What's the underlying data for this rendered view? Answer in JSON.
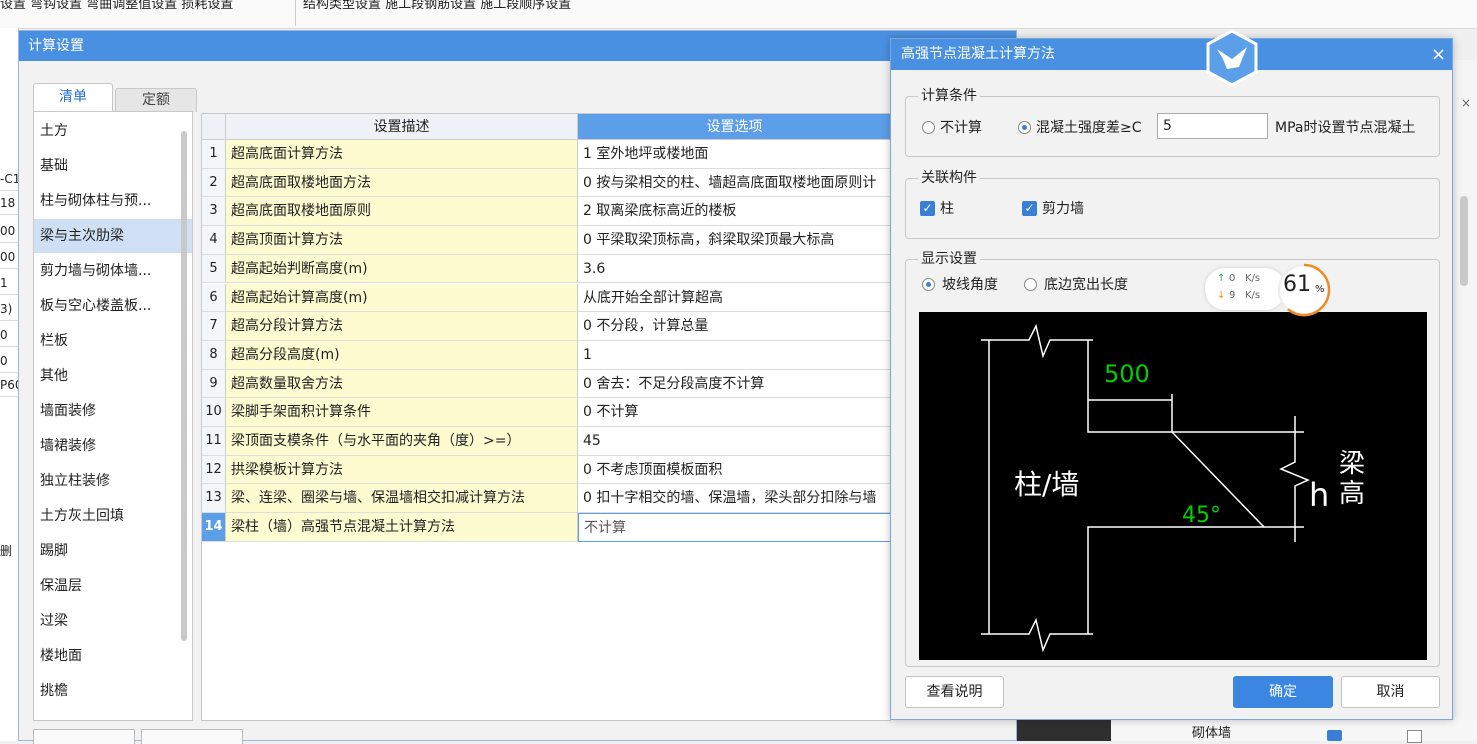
{
  "background": {
    "tabs_a": "设置  弯钩设置  弯曲调整值设置  损耗设置",
    "tabs_b": "结构类型设置  施工段钢筋设置  施工段顺序设置",
    "left_cells": [
      "-C1",
      "18",
      "00",
      "00",
      "1",
      "3)",
      "0",
      "0",
      "P60"
    ],
    "bottom_partial": "删",
    "bottom_right_text": "砌体墙",
    "right_close": "×"
  },
  "dialog": {
    "title": "计算设置",
    "tabs": [
      {
        "label": "清单"
      },
      {
        "label": "定额"
      }
    ],
    "categories": [
      "土方",
      "基础",
      "柱与砌体柱与预...",
      "梁与主次肋梁",
      "剪力墙与砌体墙...",
      "板与空心楼盖板...",
      "栏板",
      "其他",
      "墙面装修",
      "墙裙装修",
      "独立柱装修",
      "土方灰土回填",
      "踢脚",
      "保温层",
      "过梁",
      "楼地面",
      "挑檐"
    ],
    "selected_category": 3,
    "grid": {
      "headers": {
        "desc": "设置描述",
        "opt": "设置选项"
      },
      "rows": [
        {
          "num": "1",
          "desc": "超高底面计算方法",
          "opt": "1 室外地坪或楼地面"
        },
        {
          "num": "2",
          "desc": "超高底面取楼地面方法",
          "opt": "0 按与梁相交的柱、墙超高底面取楼地面原则计"
        },
        {
          "num": "3",
          "desc": "超高底面取楼地面原则",
          "opt": "2 取离梁底标高近的楼板"
        },
        {
          "num": "4",
          "desc": "超高顶面计算方法",
          "opt": "0 平梁取梁顶标高，斜梁取梁顶最大标高"
        },
        {
          "num": "5",
          "desc": "超高起始判断高度(m)",
          "opt": "3.6"
        },
        {
          "num": "6",
          "desc": "超高起始计算高度(m)",
          "opt": "从底开始全部计算超高"
        },
        {
          "num": "7",
          "desc": "超高分段计算方法",
          "opt": "0 不分段，计算总量"
        },
        {
          "num": "8",
          "desc": "超高分段高度(m)",
          "opt": "1"
        },
        {
          "num": "9",
          "desc": "超高数量取舍方法",
          "opt": "0 舍去：不足分段高度不计算"
        },
        {
          "num": "10",
          "desc": "梁脚手架面积计算条件",
          "opt": "0 不计算"
        },
        {
          "num": "11",
          "desc": "梁顶面支模条件（与水平面的夹角（度）>=）",
          "opt": "45"
        },
        {
          "num": "12",
          "desc": "拱梁模板计算方法",
          "opt": "0 不考虑顶面模板面积"
        },
        {
          "num": "13",
          "desc": "梁、连梁、圈梁与墙、保温墙相交扣减计算方法",
          "opt": "0 扣十字相交的墙、保温墙，梁头部分扣除与墙"
        },
        {
          "num": "14",
          "desc": "梁柱（墙）高强节点混凝土计算方法",
          "opt": "不计算"
        }
      ]
    }
  },
  "sub": {
    "title": "高强节点混凝土计算方法",
    "close": "×",
    "calc_group": {
      "label": "计算条件",
      "opt_none": "不计算",
      "opt_diff": "混凝土强度差≥C",
      "value": "5",
      "suffix": "MPa时设置节点混凝土",
      "selected": "opt_diff"
    },
    "rel_group": {
      "label": "关联构件",
      "col": "柱",
      "wall": "剪力墙"
    },
    "disp_group": {
      "label": "显示设置",
      "opt_angle": "坡线角度",
      "opt_len": "底边宽出长度",
      "selected": "opt_angle"
    },
    "diagram": {
      "dim": "500",
      "angle": "45°",
      "col_label": "柱/墙",
      "h_label": "h",
      "beam_label_1": "梁",
      "beam_label_2": "高",
      "line_color": "#ffffff",
      "dim_color": "#00d000"
    },
    "buttons": {
      "help": "查看说明",
      "ok": "确定",
      "cancel": "取消"
    }
  },
  "network": {
    "up": "0",
    "down": "9",
    "unit": "K/s",
    "percent": "61",
    "percent_sign": "%",
    "percent_value": 61
  }
}
